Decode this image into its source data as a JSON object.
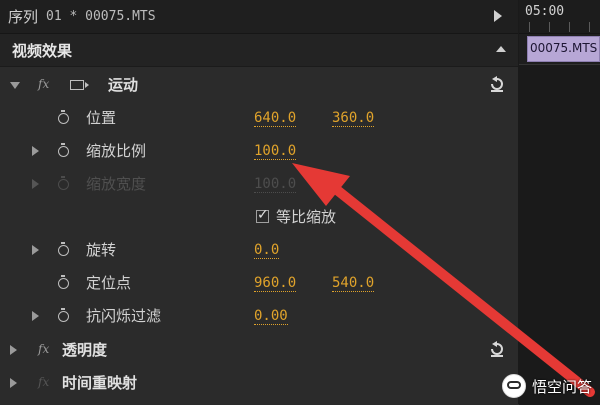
{
  "sequence": {
    "label": "序列",
    "name": "01 * 00075.MTS"
  },
  "panel": {
    "title": "视频效果"
  },
  "effects": {
    "motion": {
      "name": "运动",
      "properties": {
        "position": {
          "label": "位置",
          "x": "640.0",
          "y": "360.0"
        },
        "scale": {
          "label": "缩放比例",
          "value": "100.0"
        },
        "scale_width": {
          "label": "缩放宽度",
          "value": "100.0"
        },
        "uniform_scale": {
          "label": "等比缩放",
          "checked": true
        },
        "rotation": {
          "label": "旋转",
          "value": "0.0"
        },
        "anchor": {
          "label": "定位点",
          "x": "960.0",
          "y": "540.0"
        },
        "anti_flicker": {
          "label": "抗闪烁过滤",
          "value": "0.00"
        }
      }
    },
    "opacity": {
      "name": "透明度"
    },
    "time_remap": {
      "name": "时间重映射"
    }
  },
  "timeline": {
    "time_label": "05:00",
    "clip_label": "00075.MTS"
  },
  "watermark": {
    "text": "悟空问答"
  },
  "colors": {
    "value_accent": "#e0a32b",
    "arrow": "#e53935",
    "clip_fill": "#b7a7d6"
  },
  "icons": {
    "stopwatch": "stopwatch-icon",
    "reset": "reset-icon",
    "fx": "fx-badge-icon",
    "motion": "motion-effect-icon"
  }
}
